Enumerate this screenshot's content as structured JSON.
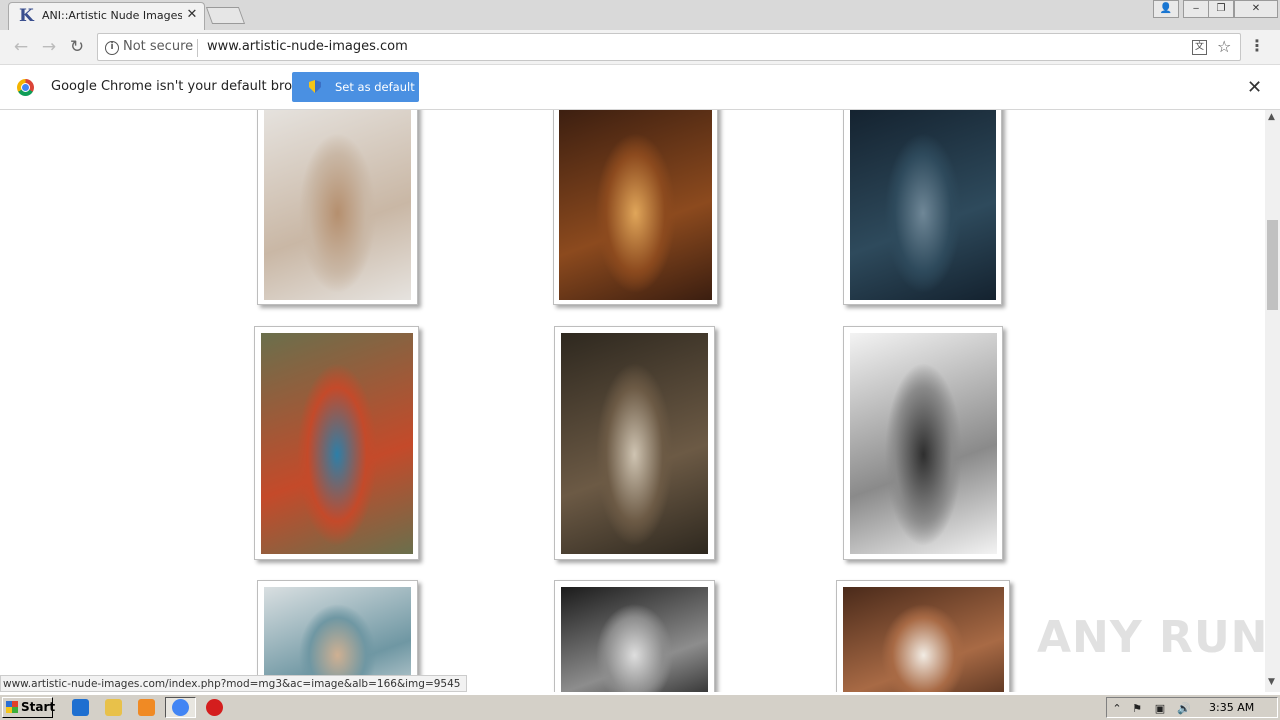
{
  "browser": {
    "tab_title": "ANI::Artistic Nude Images::",
    "tab_favicon_letter": "K",
    "tab_close": "✕",
    "security_label": "Not secure",
    "url": "www.artistic-nude-images.com",
    "menu_glyph": "⋮"
  },
  "window_controls": {
    "user": "👤",
    "minimize": "‒",
    "restore": "❐",
    "close": "✕"
  },
  "navigation": {
    "back": "←",
    "forward": "→",
    "reload": "↻",
    "star": "☆"
  },
  "infobar": {
    "message": "Google Chrome isn't your default browser",
    "set_default_label": "Set as default",
    "close": "✕"
  },
  "gallery": {
    "photos": [
      {
        "name": "photo-row1-col1",
        "palette": [
          "#e6e3df",
          "#c9b7a5",
          "#b58f6e"
        ]
      },
      {
        "name": "photo-row1-col2",
        "palette": [
          "#3b1e10",
          "#8c4a1e",
          "#e0a65a"
        ]
      },
      {
        "name": "photo-row1-col3",
        "palette": [
          "#14222f",
          "#2e4a5c",
          "#6f8797"
        ]
      },
      {
        "name": "photo-row2-col1",
        "palette": [
          "#6a6f4c",
          "#c44a2a",
          "#2d7fa8"
        ]
      },
      {
        "name": "photo-row2-col2",
        "palette": [
          "#2e281f",
          "#6c5a45",
          "#cfc4b2"
        ]
      },
      {
        "name": "photo-row2-col3",
        "palette": [
          "#f3f3f3",
          "#8a8a8a",
          "#2e2e2e"
        ]
      },
      {
        "name": "photo-row3-col1",
        "palette": [
          "#d9dfe1",
          "#6f97a3",
          "#cfb092"
        ]
      },
      {
        "name": "photo-row3-col2",
        "palette": [
          "#1b1b1b",
          "#8d8d8d",
          "#dedede"
        ]
      },
      {
        "name": "photo-row3-col3",
        "palette": [
          "#4a2a1a",
          "#a86a45",
          "#f2ece4"
        ]
      }
    ]
  },
  "status_url": "www.artistic-nude-images.com/index.php?mod=mg3&ac=image&alb=166&img=9545",
  "watermark": "ANY RUN",
  "taskbar": {
    "start_label": "Start",
    "clock": "3:35 AM",
    "apps": [
      {
        "name": "internet-explorer-icon",
        "color": "#1e6fd0"
      },
      {
        "name": "file-explorer-icon",
        "color": "#e8c14a"
      },
      {
        "name": "media-player-icon",
        "color": "#f08a24"
      },
      {
        "name": "chrome-icon",
        "color": "#4285f4"
      },
      {
        "name": "opera-icon",
        "color": "#d41e1e"
      }
    ],
    "tray": [
      "⌃",
      "⚑",
      "▣",
      "🔊"
    ]
  }
}
